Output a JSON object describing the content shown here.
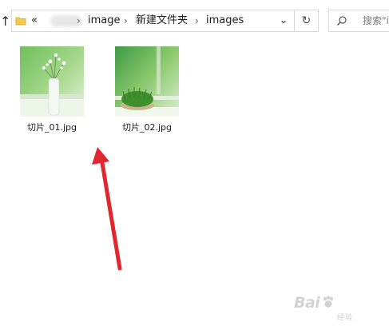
{
  "breadcrumb": {
    "overflow": "«",
    "items": [
      "image",
      "新建文件夹",
      "images"
    ]
  },
  "search": {
    "placeholder": "搜索\"i"
  },
  "files": [
    {
      "name": "切片_01.jpg"
    },
    {
      "name": "切片_02.jpg"
    }
  ],
  "icons": {
    "up": "up-arrow-icon",
    "folder": "folder-icon",
    "dropdown": "chevron-down-icon",
    "refresh": "refresh-icon",
    "search": "search-icon"
  },
  "colors": {
    "arrow": "#e0262f",
    "border": "#d9d9d9",
    "folder": "#f2c94c"
  },
  "watermark": {
    "logo": "Bai",
    "sub": "经验"
  }
}
